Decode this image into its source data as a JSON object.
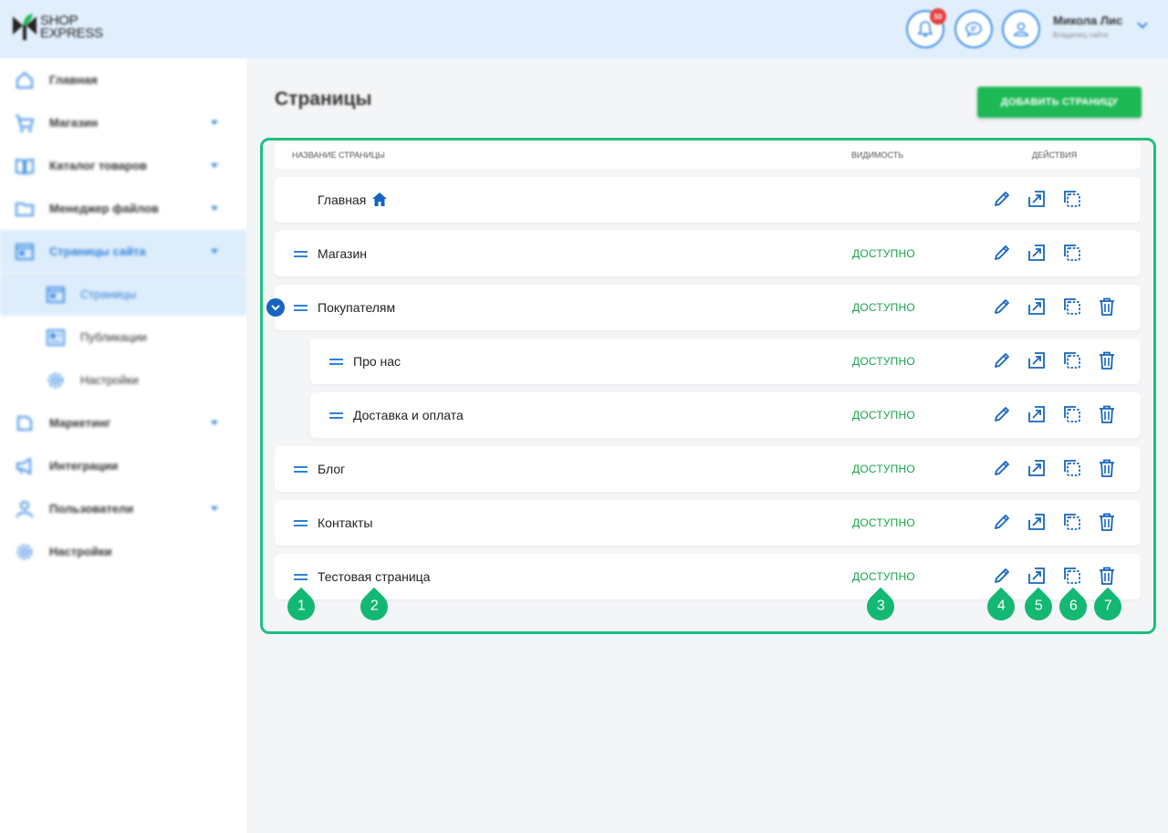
{
  "header": {
    "logo_line1": "SHOP",
    "logo_line2": "EXPRESS",
    "notification_count": "50",
    "user_name": "Микола Лис",
    "user_role": "Владелец сайта"
  },
  "sidebar": {
    "items": [
      {
        "label": "Главная"
      },
      {
        "label": "Магазин"
      },
      {
        "label": "Каталог товаров"
      },
      {
        "label": "Менеджер файлов"
      },
      {
        "label": "Страницы сайта"
      },
      {
        "label": "Страницы"
      },
      {
        "label": "Публикации"
      },
      {
        "label": "Настройки"
      },
      {
        "label": "Маркетинг"
      },
      {
        "label": "Интеграции"
      },
      {
        "label": "Пользователи"
      },
      {
        "label": "Настройки"
      }
    ]
  },
  "main": {
    "title": "Страницы",
    "add_button": "ДОБАВИТЬ СТРАНИЦУ",
    "columns": {
      "name": "НАЗВАНИЕ СТРАНИЦЫ",
      "visibility": "ВИДИМОСТЬ",
      "actions": "ДЕЙСТВИЯ"
    },
    "rows": [
      {
        "name": "Главная",
        "visibility": ""
      },
      {
        "name": "Магазин",
        "visibility": "ДОСТУПНО"
      },
      {
        "name": "Покупателям",
        "visibility": "ДОСТУПНО"
      },
      {
        "name": "Про нас",
        "visibility": "ДОСТУПНО"
      },
      {
        "name": "Доставка и оплата",
        "visibility": "ДОСТУПНО"
      },
      {
        "name": "Блог",
        "visibility": "ДОСТУПНО"
      },
      {
        "name": "Контакты",
        "visibility": "ДОСТУПНО"
      },
      {
        "name": "Тестовая страница",
        "visibility": "ДОСТУПНО"
      }
    ]
  },
  "markers": [
    "1",
    "2",
    "3",
    "4",
    "5",
    "6",
    "7"
  ],
  "colors": {
    "accent": "#2e82d9",
    "success": "#1aa34a",
    "marker": "#13b873",
    "header_bg": "#e1effc"
  }
}
